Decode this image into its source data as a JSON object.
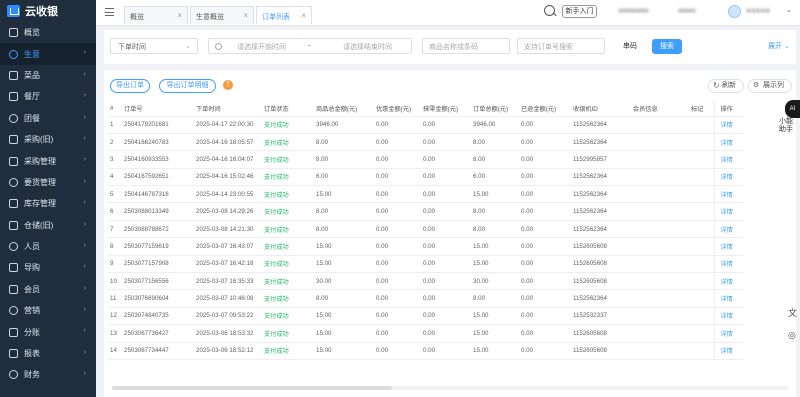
{
  "app": {
    "logo_text": "云收银"
  },
  "sidebar": {
    "items": [
      {
        "label": "概览",
        "icon": "home-icon"
      },
      {
        "label": "生意",
        "icon": "business-icon",
        "active": true
      },
      {
        "label": "菜品",
        "icon": "dish-icon"
      },
      {
        "label": "餐厅",
        "icon": "restaurant-icon"
      },
      {
        "label": "团餐",
        "icon": "group-meal-icon"
      },
      {
        "label": "采购(旧)",
        "icon": "cart-icon"
      },
      {
        "label": "采购管理",
        "icon": "purchase-icon"
      },
      {
        "label": "要货管理",
        "icon": "request-icon"
      },
      {
        "label": "库存管理",
        "icon": "inventory-icon"
      },
      {
        "label": "仓储(旧)",
        "icon": "warehouse-icon"
      },
      {
        "label": "人员",
        "icon": "person-icon"
      },
      {
        "label": "导购",
        "icon": "guide-icon"
      },
      {
        "label": "会员",
        "icon": "member-icon"
      },
      {
        "label": "营销",
        "icon": "marketing-icon"
      },
      {
        "label": "分账",
        "icon": "split-icon"
      },
      {
        "label": "报表",
        "icon": "report-icon"
      },
      {
        "label": "财务",
        "icon": "finance-icon"
      }
    ]
  },
  "topbar": {
    "tabs": [
      {
        "label": "概览"
      },
      {
        "label": "生意概览"
      },
      {
        "label": "订单列表",
        "active": true
      }
    ],
    "guide_label": "新手入门",
    "store_name_a": "■■■■■■■",
    "store_name_b": "■■■■",
    "user_name": "■■■■■"
  },
  "filters": {
    "time_type": "下单时间",
    "start_placeholder": "请选择开始时间",
    "separator": "-",
    "end_placeholder": "请选择结束时间",
    "product_placeholder": "商品名称或条码",
    "order_placeholder": "支持订单号搜索",
    "channel": "串码",
    "search_label": "搜索",
    "expand_label": "展开"
  },
  "toolbar": {
    "export_orders": "导出订单",
    "export_details": "导出订单明细",
    "help": "!",
    "refresh": "刷新",
    "columns": "展示列"
  },
  "table": {
    "headers": [
      "#",
      "订单号",
      "下单时间",
      "订单状态",
      "商品总金额(元)",
      "优惠金额(元)",
      "抹零金额(元)",
      "订单总额(元)",
      "已退金额(元)",
      "收银机ID",
      "会员信息",
      "标记",
      "操作"
    ],
    "rows": [
      [
        "1",
        "2504179201681",
        "2025-04-17 22:00:30",
        "支付成功",
        "3946.00",
        "0.00",
        "0.00",
        "3946.00",
        "0.00",
        "1152562364",
        "",
        "",
        "详情"
      ],
      [
        "2",
        "2504166240783",
        "2025-04-16 18:05:57",
        "支付成功",
        "8.00",
        "0.00",
        "0.00",
        "8.00",
        "0.00",
        "1152562364",
        "",
        "",
        "详情"
      ],
      [
        "3",
        "2504160933553",
        "2025-04-16 16:04:07",
        "支付成功",
        "8.00",
        "0.00",
        "0.00",
        "8.00",
        "0.00",
        "1152995857",
        "",
        "",
        "详情"
      ],
      [
        "4",
        "2504167592651",
        "2025-04-16 15:02:46",
        "支付成功",
        "6.00",
        "0.00",
        "0.00",
        "6.00",
        "0.00",
        "1152562364",
        "",
        "",
        "详情"
      ],
      [
        "5",
        "2504146787316",
        "2025-04-14 23:00:55",
        "支付成功",
        "15.00",
        "0.00",
        "0.00",
        "15.00",
        "0.00",
        "1152562364",
        "",
        "",
        "详情"
      ],
      [
        "6",
        "2503088013349",
        "2025-03-08 14:29:26",
        "支付成功",
        "8.00",
        "0.00",
        "0.00",
        "8.00",
        "0.00",
        "1152562364",
        "",
        "",
        "详情"
      ],
      [
        "7",
        "2503088788672",
        "2025-03-08 14:21:30",
        "支付成功",
        "8.00",
        "0.00",
        "0.00",
        "8.00",
        "0.00",
        "1152562364",
        "",
        "",
        "详情"
      ],
      [
        "8",
        "2503077159619",
        "2025-03-07 16:43:07",
        "支付成功",
        "15.00",
        "0.00",
        "0.00",
        "15.00",
        "0.00",
        "1152605608",
        "",
        "",
        "详情"
      ],
      [
        "9",
        "2503077157908",
        "2025-03-07 16:42:18",
        "支付成功",
        "15.00",
        "0.00",
        "0.00",
        "15.00",
        "0.00",
        "1152605608",
        "",
        "",
        "详情"
      ],
      [
        "10",
        "2503077156556",
        "2025-03-07 16:35:33",
        "支付成功",
        "30.00",
        "0.00",
        "0.00",
        "30.00",
        "0.00",
        "1152605608",
        "",
        "",
        "详情"
      ],
      [
        "11",
        "2503076690604",
        "2025-03-07 10:46:08",
        "支付成功",
        "8.00",
        "0.00",
        "0.00",
        "8.00",
        "0.00",
        "1152562364",
        "",
        "",
        "详情"
      ],
      [
        "12",
        "2503074840735",
        "2025-03-07 09:53:22",
        "支付成功",
        "15.00",
        "0.00",
        "0.00",
        "15.00",
        "0.00",
        "1152532337",
        "",
        "",
        "详情"
      ],
      [
        "13",
        "2503067736427",
        "2025-03-06 18:53:32",
        "支付成功",
        "15.00",
        "0.00",
        "0.00",
        "15.00",
        "0.00",
        "1152605608",
        "",
        "",
        "详情"
      ],
      [
        "14",
        "2503067734447",
        "2025-03-06 18:52:12",
        "支付成功",
        "15.00",
        "0.00",
        "0.00",
        "15.00",
        "0.00",
        "1152605608",
        "",
        "",
        "详情"
      ]
    ]
  },
  "float": {
    "ai_badge": "AI",
    "text_line1": "小",
    "text_line2": "能",
    "text_line3": "助",
    "text_line4": "手"
  }
}
